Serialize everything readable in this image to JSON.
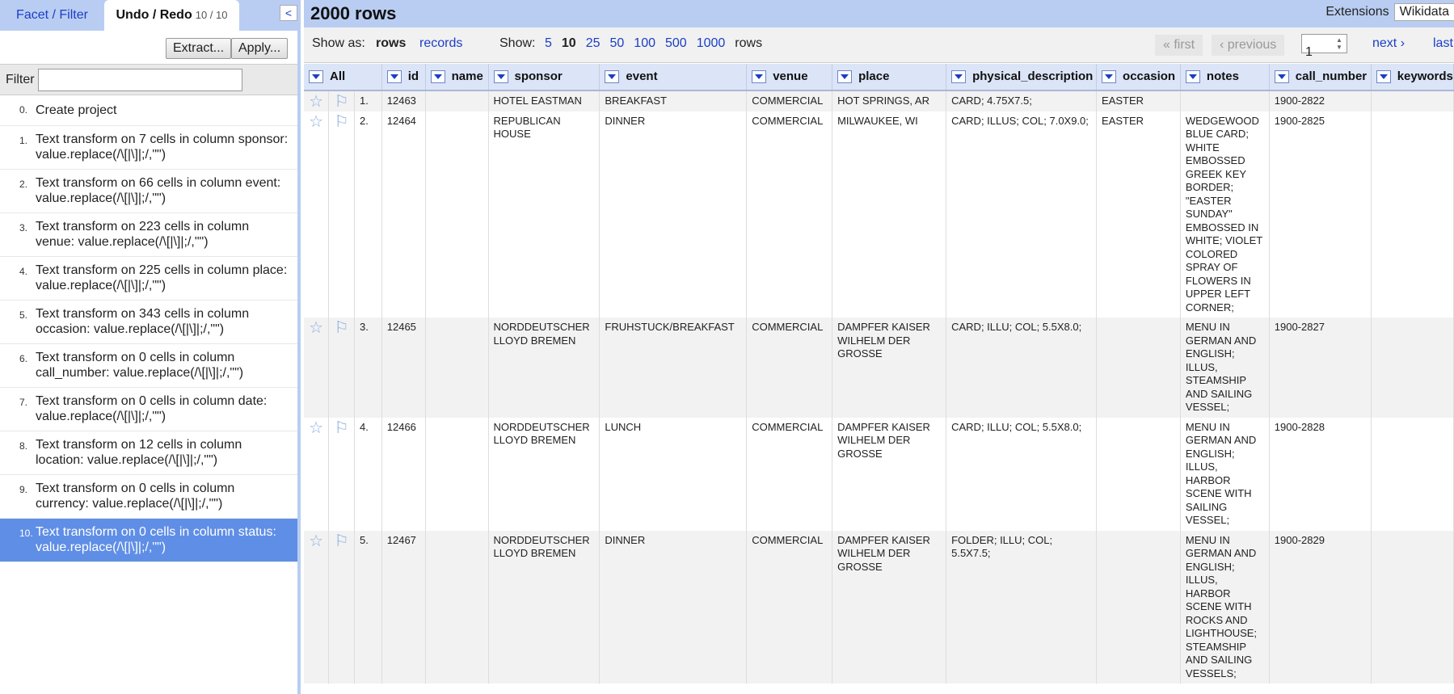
{
  "left": {
    "tabs": {
      "facet": "Facet / Filter",
      "undo": "Undo / Redo",
      "undo_count": "10 / 10"
    },
    "collapse_glyph": "<",
    "buttons": {
      "extract": "Extract...",
      "apply": "Apply..."
    },
    "filter": {
      "label": "Filter",
      "value": ""
    },
    "history": [
      {
        "num": "0.",
        "text": "Create project"
      },
      {
        "num": "1.",
        "text": "Text transform on 7 cells in column sponsor: value.replace(/\\[|\\]|;/,\"\")"
      },
      {
        "num": "2.",
        "text": "Text transform on 66 cells in column event: value.replace(/\\[|\\]|;/,\"\")"
      },
      {
        "num": "3.",
        "text": "Text transform on 223 cells in column venue: value.replace(/\\[|\\]|;/,\"\")"
      },
      {
        "num": "4.",
        "text": "Text transform on 225 cells in column place: value.replace(/\\[|\\]|;/,\"\")"
      },
      {
        "num": "5.",
        "text": "Text transform on 343 cells in column occasion: value.replace(/\\[|\\]|;/,\"\")"
      },
      {
        "num": "6.",
        "text": "Text transform on 0 cells in column call_number: value.replace(/\\[|\\]|;/,\"\")"
      },
      {
        "num": "7.",
        "text": "Text transform on 0 cells in column date: value.replace(/\\[|\\]|;/,\"\")"
      },
      {
        "num": "8.",
        "text": "Text transform on 12 cells in column location: value.replace(/\\[|\\]|;/,\"\")"
      },
      {
        "num": "9.",
        "text": "Text transform on 0 cells in column currency: value.replace(/\\[|\\]|;/,\"\")"
      },
      {
        "num": "10.",
        "text": "Text transform on 0 cells in column status: value.replace(/\\[|\\]|;/,\"\")"
      }
    ]
  },
  "main": {
    "row_count": "2000 rows",
    "extensions": "Extensions",
    "wikidata": "Wikidata",
    "show_as": {
      "label": "Show as:",
      "rows": "rows",
      "records": "records"
    },
    "show": {
      "label": "Show:",
      "options": [
        "5",
        "10",
        "25",
        "50",
        "100",
        "500",
        "1000"
      ],
      "selected": "10",
      "suffix": "rows"
    },
    "pager": {
      "first": "« first",
      "previous": "‹ previous",
      "page": "1",
      "next": "next ›",
      "last": "last"
    },
    "columns": [
      "All",
      "id",
      "name",
      "sponsor",
      "event",
      "venue",
      "place",
      "physical_description",
      "occasion",
      "notes",
      "call_number",
      "keywords"
    ],
    "rows": [
      {
        "idx": "1.",
        "id": "12463",
        "name": "",
        "sponsor": "HOTEL EASTMAN",
        "event": "BREAKFAST",
        "venue": "COMMERCIAL",
        "place": "HOT SPRINGS, AR",
        "physical_description": "CARD; 4.75X7.5;",
        "occasion": "EASTER",
        "notes": "",
        "call_number": "1900-2822",
        "keywords": ""
      },
      {
        "idx": "2.",
        "id": "12464",
        "name": "",
        "sponsor": "REPUBLICAN HOUSE",
        "event": "DINNER",
        "venue": "COMMERCIAL",
        "place": "MILWAUKEE, WI",
        "physical_description": "CARD; ILLUS; COL; 7.0X9.0;",
        "occasion": "EASTER",
        "notes": "WEDGEWOOD BLUE CARD; WHITE EMBOSSED GREEK KEY BORDER; \"EASTER SUNDAY\" EMBOSSED IN WHITE; VIOLET COLORED SPRAY OF FLOWERS IN UPPER LEFT CORNER;",
        "call_number": "1900-2825",
        "keywords": ""
      },
      {
        "idx": "3.",
        "id": "12465",
        "name": "",
        "sponsor": "NORDDEUTSCHER LLOYD BREMEN",
        "event": "FRUHSTUCK/BREAKFAST",
        "venue": "COMMERCIAL",
        "place": "DAMPFER KAISER WILHELM DER GROSSE",
        "physical_description": "CARD; ILLU; COL; 5.5X8.0;",
        "occasion": "",
        "notes": "MENU IN GERMAN AND ENGLISH; ILLUS, STEAMSHIP AND SAILING VESSEL;",
        "call_number": "1900-2827",
        "keywords": ""
      },
      {
        "idx": "4.",
        "id": "12466",
        "name": "",
        "sponsor": "NORDDEUTSCHER LLOYD BREMEN",
        "event": "LUNCH",
        "venue": "COMMERCIAL",
        "place": "DAMPFER KAISER WILHELM DER GROSSE",
        "physical_description": "CARD; ILLU; COL; 5.5X8.0;",
        "occasion": "",
        "notes": "MENU IN GERMAN AND ENGLISH; ILLUS, HARBOR SCENE WITH SAILING VESSEL;",
        "call_number": "1900-2828",
        "keywords": ""
      },
      {
        "idx": "5.",
        "id": "12467",
        "name": "",
        "sponsor": "NORDDEUTSCHER LLOYD BREMEN",
        "event": "DINNER",
        "venue": "COMMERCIAL",
        "place": "DAMPFER KAISER WILHELM DER GROSSE",
        "physical_description": "FOLDER; ILLU; COL; 5.5X7.5;",
        "occasion": "",
        "notes": "MENU IN GERMAN AND ENGLISH; ILLUS, HARBOR SCENE WITH ROCKS AND LIGHTHOUSE; STEAMSHIP AND SAILING VESSELS;",
        "call_number": "1900-2829",
        "keywords": ""
      }
    ],
    "icons": {
      "star": "star-icon",
      "flag": "flag-icon"
    }
  }
}
